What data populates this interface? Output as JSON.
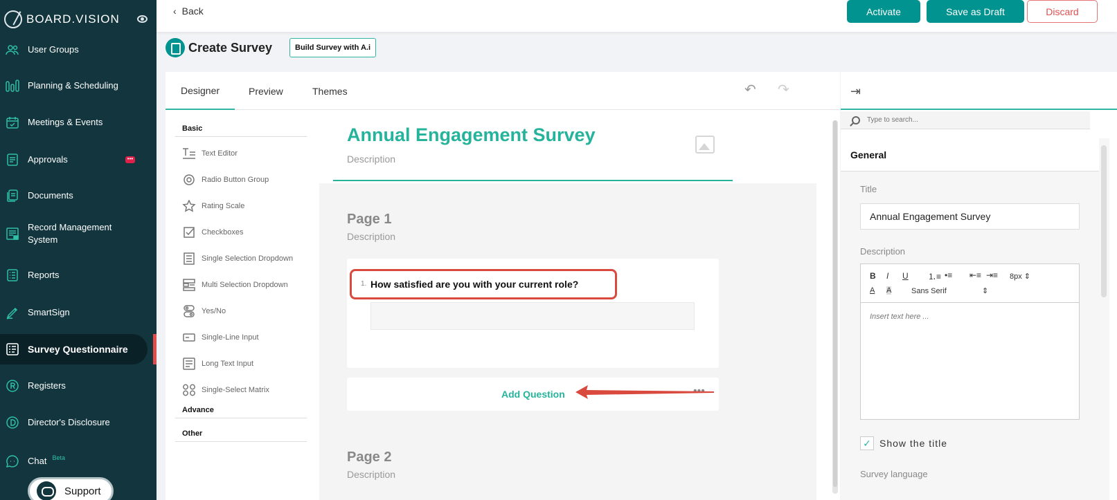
{
  "brand": {
    "name": "BOARD.VISION"
  },
  "sidebar": {
    "items": [
      {
        "label": "User Groups",
        "icon": "users-icon"
      },
      {
        "label": "Planning & Scheduling",
        "icon": "bar-chart-icon"
      },
      {
        "label": "Meetings & Events",
        "icon": "calendar-icon"
      },
      {
        "label": "Approvals",
        "icon": "document-icon",
        "badge": "•••"
      },
      {
        "label": "Documents",
        "icon": "documents-icon"
      },
      {
        "label": "Record Management System",
        "icon": "records-icon"
      },
      {
        "label": "Reports",
        "icon": "reports-icon"
      },
      {
        "label": "SmartSign",
        "icon": "pen-icon"
      },
      {
        "label": "Survey Questionnaire",
        "icon": "survey-icon",
        "active": true
      },
      {
        "label": "Registers",
        "icon": "registered-icon"
      },
      {
        "label": "Director's Disclosure",
        "icon": "disclosure-icon"
      },
      {
        "label": "Chat",
        "icon": "chat-icon",
        "tag": "Beta"
      }
    ],
    "support_label": "Support"
  },
  "topbar": {
    "back_label": "Back",
    "activate_label": "Activate",
    "save_draft_label": "Save as Draft",
    "discard_label": "Discard"
  },
  "header": {
    "title": "Create Survey",
    "ai_button": "Build Survey with A.i"
  },
  "designer": {
    "tabs": [
      "Designer",
      "Preview",
      "Themes"
    ],
    "active_tab": "Designer",
    "toolbox": {
      "categories": [
        "Basic",
        "Advance",
        "Other"
      ],
      "items": [
        {
          "label": "Text Editor",
          "icon": "text-editor-icon"
        },
        {
          "label": "Radio Button Group",
          "icon": "radio-icon"
        },
        {
          "label": "Rating Scale",
          "icon": "star-icon"
        },
        {
          "label": "Checkboxes",
          "icon": "checkbox-icon"
        },
        {
          "label": "Single Selection Dropdown",
          "icon": "dropdown-icon"
        },
        {
          "label": "Multi Selection Dropdown",
          "icon": "multi-dropdown-icon"
        },
        {
          "label": "Yes/No",
          "icon": "toggle-icon"
        },
        {
          "label": "Single-Line Input",
          "icon": "input-icon"
        },
        {
          "label": "Long Text Input",
          "icon": "textarea-icon"
        },
        {
          "label": "Single-Select Matrix",
          "icon": "matrix-icon"
        }
      ]
    },
    "survey": {
      "title": "Annual Engagement Survey",
      "description": "Description",
      "pages": [
        {
          "title": "Page 1",
          "description": "Description",
          "questions": [
            {
              "number": "1.",
              "text": "How satisfied are you with your current role?"
            }
          ]
        },
        {
          "title": "Page 2",
          "description": "Description"
        }
      ],
      "add_question_label": "Add Question"
    }
  },
  "properties": {
    "search_placeholder": "Type to search...",
    "section": "General",
    "title_label": "Title",
    "title_value": "Annual Engagement Survey",
    "description_label": "Description",
    "editor": {
      "font_size": "8px",
      "font_family": "Sans Serif",
      "placeholder": "Insert text here ..."
    },
    "show_title_label": "Show the title",
    "show_title_checked": true,
    "survey_language_label": "Survey language"
  },
  "colors": {
    "sidebar_bg": "#12353e",
    "accent_teal": "#00938f",
    "survey_green": "#25b39b",
    "alert_red": "#d9493d"
  }
}
